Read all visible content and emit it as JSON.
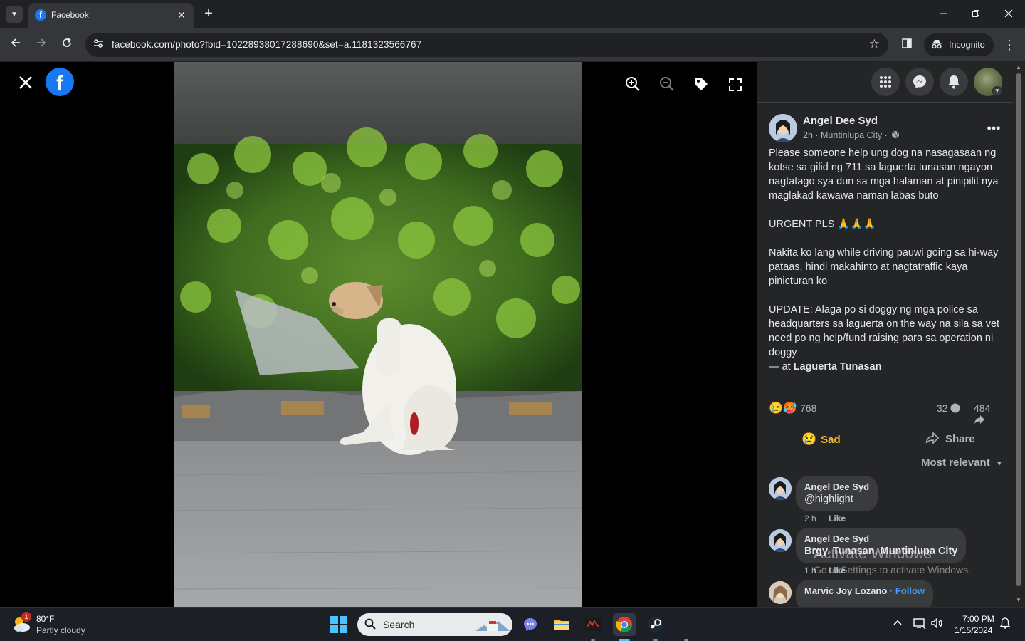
{
  "browser": {
    "tab_title": "Facebook",
    "tab_favicon": "f",
    "url": "facebook.com/photo?fbid=10228938017288690&set=a.1181323566767",
    "incognito_label": "Incognito"
  },
  "viewer": {
    "logo": "f"
  },
  "post": {
    "author": "Angel Dee Syd",
    "meta": "2h · Muntinlupa City ·",
    "paragraphs": [
      "Please someone help ung dog na nasagasaan ng kotse sa gilid ng 711 sa laguerta tunasan ngayon nagtatago sya dun sa mga halaman at pinipilit nya maglakad kawawa naman labas buto",
      "URGENT PLS 🙏🙏🙏",
      "Nakita ko lang while driving pauwi going sa hi-way pataas, hindi makahinto at nagtatraffic kaya pinicturan ko",
      "UPDATE: Alaga po si doggy ng mga police sa headquarters sa laguerta on the way na sila sa vet need po ng help/fund raising para sa operation ni doggy"
    ],
    "location_prefix": "— at",
    "location": "Laguerta Tunasan",
    "reaction_emojis": "😢🥵",
    "reaction_count": "768",
    "comment_count": "32",
    "share_count": "484",
    "sad_label": "Sad",
    "share_label": "Share",
    "sort_label": "Most relevant"
  },
  "comments": [
    {
      "name": "Angel Dee Syd",
      "text": "@highlight",
      "time": "2 h",
      "like": "Like"
    },
    {
      "name": "Angel Dee Syd",
      "text": "Brgy. Tunasan, Muntinlupa City",
      "time": "1 h",
      "like": "Like"
    },
    {
      "name": "Marvic Joy Lozano",
      "follow": "· Follow",
      "text": "",
      "time": "",
      "like": ""
    }
  ],
  "watermark": {
    "title": "Activate Windows",
    "subtitle": "Go to Settings to activate Windows."
  },
  "taskbar": {
    "weather_badge": "1",
    "temperature": "80°F",
    "condition": "Partly cloudy",
    "search_placeholder": "Search",
    "time": "7:00 PM",
    "date": "1/15/2024"
  }
}
